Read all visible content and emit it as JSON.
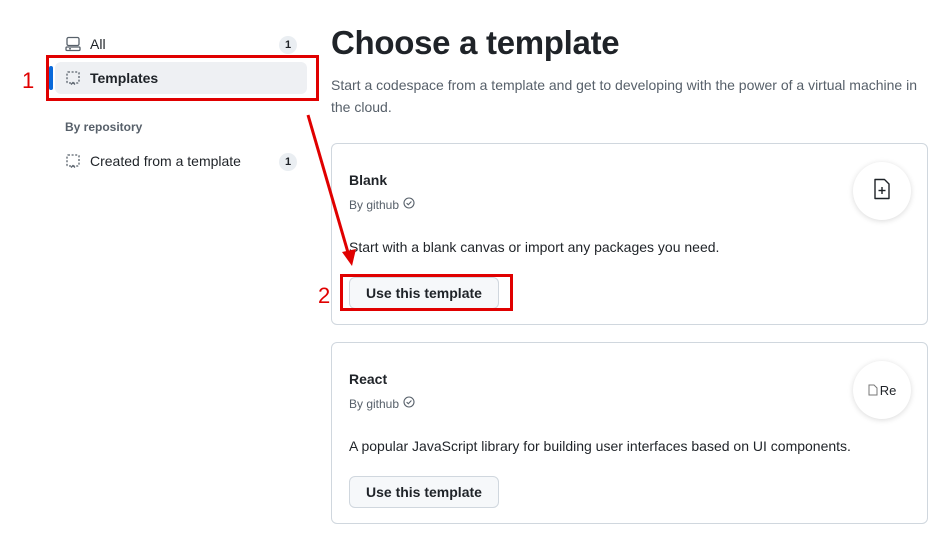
{
  "sidebar": {
    "items": [
      {
        "label": "All",
        "count": "1",
        "icon": "codespaces-icon"
      },
      {
        "label": "Templates",
        "icon": "template-icon",
        "active": true
      }
    ],
    "section_label": "By repository",
    "repo_items": [
      {
        "label": "Created from a template",
        "count": "1",
        "icon": "template-icon"
      }
    ]
  },
  "main": {
    "title": "Choose a template",
    "description": "Start a codespace from a template and get to developing with the power of a virtual machine in the cloud.",
    "templates": [
      {
        "name": "Blank",
        "author": "By github",
        "description": "Start with a blank canvas or import any packages you need.",
        "button": "Use this template",
        "icon": "file-add-icon"
      },
      {
        "name": "React",
        "author": "By github",
        "description": "A popular JavaScript library for building user interfaces based on UI components.",
        "button": "Use this template",
        "icon_alt": "Re"
      }
    ]
  },
  "annotations": {
    "step1": "1",
    "step2": "2",
    "color": "#e00000"
  },
  "colors": {
    "accent": "#0969da",
    "border": "#d0d7de",
    "muted_text": "#57606a"
  }
}
